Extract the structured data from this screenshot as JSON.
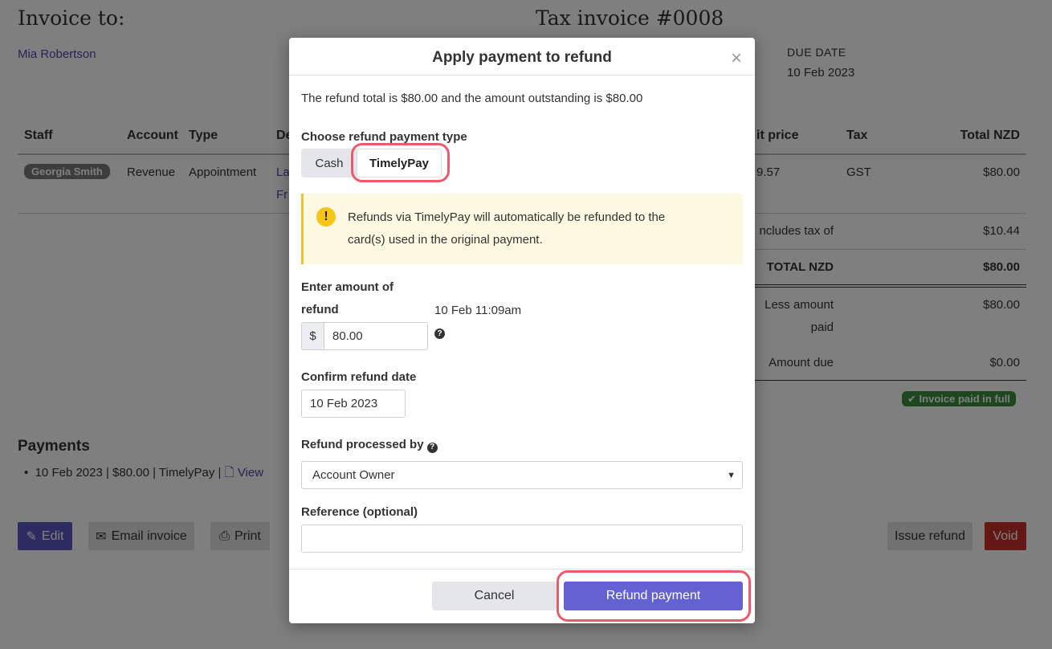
{
  "invoice": {
    "invoice_to_label": "Invoice to:",
    "title": "Tax invoice #0008",
    "customer": "Mia Robertson",
    "due_date_label": "DUE DATE",
    "due_date": "10 Feb 2023"
  },
  "table": {
    "headers": {
      "staff": "Staff",
      "account": "Account",
      "type": "Type",
      "description": "De",
      "unit_price": "it price",
      "tax": "Tax",
      "total": "Total NZD"
    },
    "row": {
      "staff": "Georgia Smith",
      "account": "Revenue",
      "type": "Appointment",
      "description_line1": "La",
      "description_line2": "Fr",
      "unit_price": "9.57",
      "tax": "GST",
      "total": "$80.00"
    }
  },
  "totals": {
    "includes_tax_label": "ncludes tax of",
    "includes_tax_value": "$10.44",
    "total_label": "TOTAL NZD",
    "total_value": "$80.00",
    "less_paid_label_1": "Less amount",
    "less_paid_label_2": "paid",
    "less_paid_value": "$80.00",
    "amount_due_label": "Amount due",
    "amount_due_value": "$0.00",
    "paid_badge": "Invoice paid in full"
  },
  "payments": {
    "heading": "Payments",
    "item_text": "10 Feb 2023 | $80.00 | TimelyPay | ",
    "view_label": "View"
  },
  "actions": {
    "edit": "Edit",
    "email": "Email invoice",
    "print": "Print",
    "issue_refund": "Issue refund",
    "void": "Void"
  },
  "modal": {
    "title": "Apply payment to refund",
    "close": "×",
    "summary": "The refund total is $80.00 and the amount outstanding is $80.00",
    "payment_type_label": "Choose refund payment type",
    "payment_types": [
      "Cash",
      "TimelyPay"
    ],
    "selected_payment_type": "TimelyPay",
    "alert_icon": "!",
    "alert_line1": "Refunds via TimelyPay will automatically be refunded to the",
    "alert_line2": "card(s) used in the original payment.",
    "amount_label_1": "Enter amount of",
    "amount_label_2": "refund",
    "currency_symbol": "$",
    "amount_value": "80.00",
    "amount_timestamp": "10 Feb 11:09am",
    "date_label": "Confirm refund date",
    "date_value": "10 Feb 2023",
    "processed_by_label": "Refund processed by",
    "processed_by_value": "Account Owner",
    "reference_label": "Reference (optional)",
    "reference_value": "",
    "cancel": "Cancel",
    "submit": "Refund payment"
  },
  "colors": {
    "accent": "#5a57c4",
    "highlight": "#ec5b6b",
    "alert_bg": "#fdf8e1",
    "paid_green": "#3e8e3e",
    "void_red": "#c9302c"
  }
}
